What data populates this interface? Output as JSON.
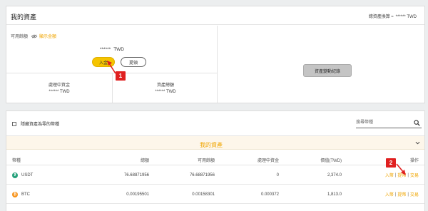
{
  "header": {
    "title": "我的資產",
    "total_label": "總資產換算 ≈",
    "total_value": "****** TWD"
  },
  "available": {
    "label": "可用餘額",
    "show_label": "顯示金額",
    "balance_mask": "******",
    "currency": "TWD",
    "deposit_label": "入金",
    "withdraw_label": "提領"
  },
  "stats": [
    {
      "label": "處理中資金",
      "value": "****** TWD"
    },
    {
      "label": "資產總額",
      "value": "****** TWD"
    }
  ],
  "history_button": "資產變動紀錄",
  "callouts": [
    "1",
    "2"
  ],
  "toolbar": {
    "hide_zero_label": "隱藏資產為零的幣種",
    "search_placeholder": "搜尋幣種"
  },
  "section_title": "我的資產",
  "table": {
    "headers": [
      "幣種",
      "總額",
      "可用餘額",
      "處理中資金",
      "價值(TWD)",
      "操作"
    ],
    "actions": [
      "入幣",
      "提幣",
      "交易"
    ],
    "rows": [
      {
        "coin": "USDT",
        "total": "76.68871956",
        "available": "76.68871956",
        "processing": "0",
        "value": "2,374.0"
      },
      {
        "coin": "BTC",
        "total": "0.00195501",
        "available": "0.00158301",
        "processing": "0.000372",
        "value": "1,813.0"
      }
    ]
  },
  "colors": {
    "accent": "#f0a500",
    "deposit_button": "#f5c400",
    "callout": "#e02020",
    "usdt": "#26a17b",
    "btc": "#f7931a"
  }
}
